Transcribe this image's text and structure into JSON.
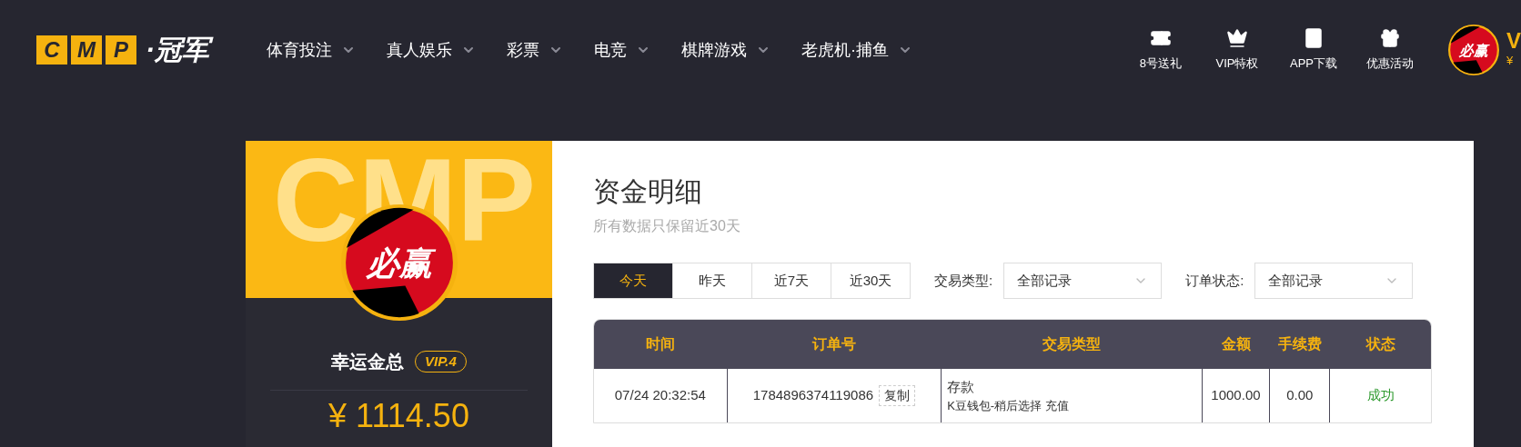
{
  "logo": {
    "letters": [
      "C",
      "M",
      "P"
    ],
    "name": "·冠军"
  },
  "nav": [
    {
      "label": "体育投注"
    },
    {
      "label": "真人娱乐"
    },
    {
      "label": "彩票"
    },
    {
      "label": "电竞"
    },
    {
      "label": "棋牌游戏"
    },
    {
      "label": "老虎机·捕鱼"
    }
  ],
  "quick_links": [
    {
      "kind": "ticket",
      "label": "8号送礼"
    },
    {
      "kind": "crown",
      "label": "VIP特权"
    },
    {
      "kind": "tablet",
      "label": "APP下载"
    },
    {
      "kind": "gift",
      "label": "优惠活动"
    }
  ],
  "header_user": {
    "avatar_text": "必赢",
    "name": "V",
    "balance": "¥"
  },
  "profile": {
    "watermark": "CMP",
    "avatar_text": "必赢",
    "name": "幸运金总",
    "vip": "VIP.4",
    "balance": "¥ 1114.50"
  },
  "page": {
    "title": "资金明细",
    "subtitle": "所有数据只保留近30天"
  },
  "ranges": [
    {
      "label": "今天",
      "selected": true
    },
    {
      "label": "昨天",
      "selected": false
    },
    {
      "label": "近7天",
      "selected": false
    },
    {
      "label": "近30天",
      "selected": false
    }
  ],
  "filters": [
    {
      "label": "交易类型:",
      "value": "全部记录"
    },
    {
      "label": "订单状态:",
      "value": "全部记录"
    }
  ],
  "table": {
    "columns": [
      "时间",
      "订单号",
      "交易类型",
      "金额",
      "手续费",
      "状态"
    ],
    "copy_label": "复制",
    "rows": [
      {
        "time": "07/24 20:32:54",
        "order": "1784896374119086",
        "type": "存款",
        "detail": "K豆钱包-稍后选择 充值",
        "amount": "1000.00",
        "fee": "0.00",
        "status": "成功"
      }
    ]
  }
}
